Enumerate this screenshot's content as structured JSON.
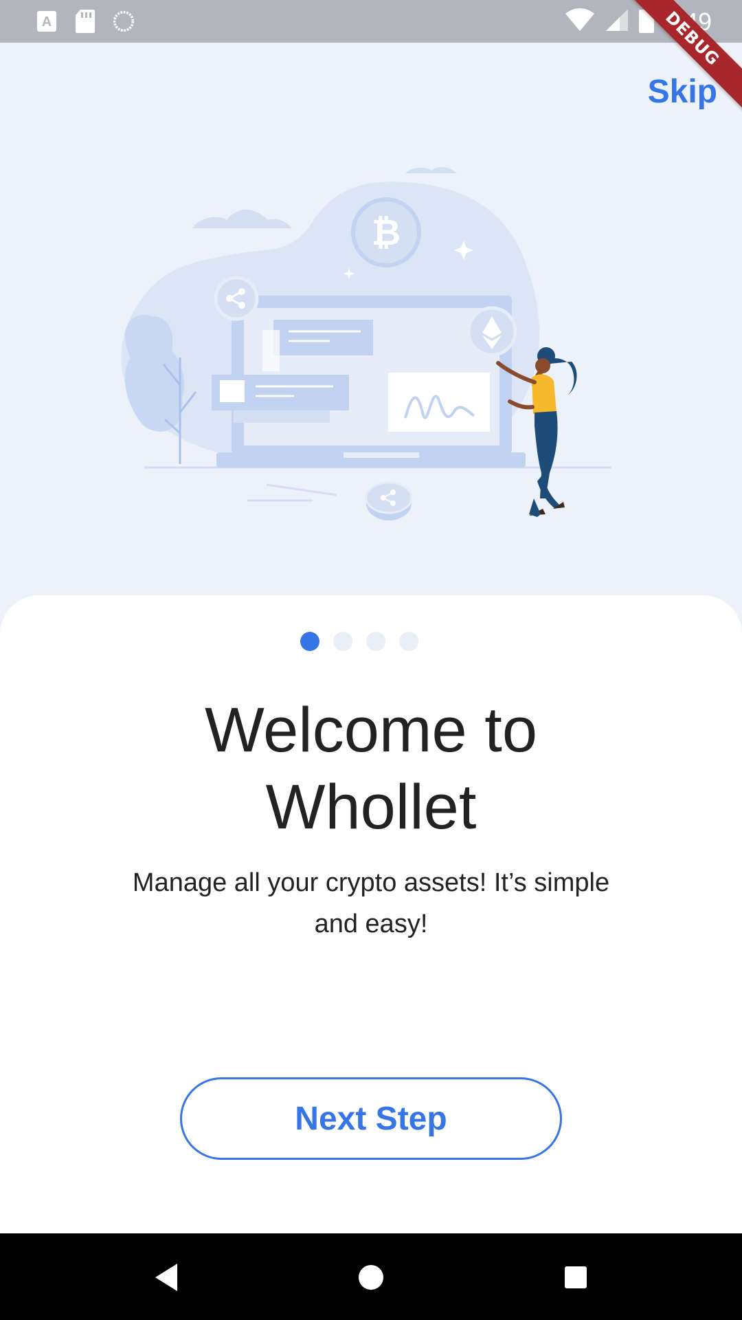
{
  "status_bar": {
    "time": "9:49",
    "icons": [
      "keyboard-a-icon",
      "sd-card-icon",
      "sync-circle-icon",
      "wifi-icon",
      "signal-icon",
      "battery-icon"
    ]
  },
  "debug_banner": "DEBUG",
  "header": {
    "skip_label": "Skip"
  },
  "illustration": {
    "name": "crypto-onboarding-illustration"
  },
  "pager": {
    "count": 4,
    "active_index": 0
  },
  "content": {
    "title": "Welcome to Whollet",
    "subtitle": "Manage all your crypto assets! It’s simple and easy!"
  },
  "actions": {
    "next_label": "Next Step"
  },
  "navigation": {
    "buttons": [
      "back-icon",
      "home-icon",
      "recents-icon"
    ]
  },
  "colors": {
    "accent": "#3575E6",
    "background": "#ECF1FA",
    "card": "#FFFFFF",
    "illustration_blue": "#C2D3F2",
    "person_shirt": "#F7B92C",
    "person_pants": "#1E4C78",
    "debug_red": "#A8272C"
  }
}
